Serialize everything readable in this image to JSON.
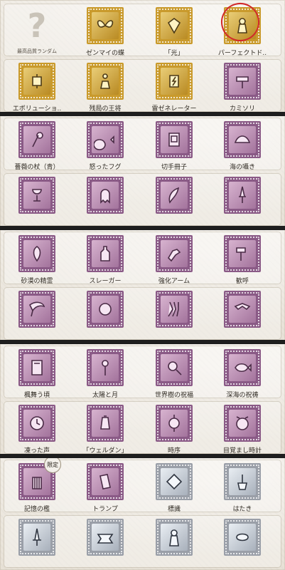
{
  "sections": [
    {
      "rows": [
        {
          "items": [
            {
              "label": "最高品質ランダム",
              "kind": "question",
              "small": true
            },
            {
              "label": "ゼンマイの蝶",
              "kind": "gold",
              "icon": "butterfly-icon"
            },
            {
              "label": "「光」",
              "kind": "gold",
              "icon": "gem-icon"
            },
            {
              "label": "パーフェクトド..",
              "kind": "gold",
              "icon": "doll-icon",
              "circled": true
            }
          ]
        },
        {
          "items": [
            {
              "label": "エボリューショ..",
              "kind": "gold",
              "icon": "mechanism-icon"
            },
            {
              "label": "残局の王将",
              "kind": "gold",
              "icon": "pawn-icon"
            },
            {
              "label": "雷ゼネレーター",
              "kind": "gold",
              "icon": "generator-icon"
            },
            {
              "label": "カミソリ",
              "kind": "purple",
              "icon": "razor-icon"
            }
          ]
        }
      ]
    },
    {
      "rows": [
        {
          "items": [
            {
              "label": "薔薇の杖（青）",
              "kind": "purple",
              "icon": "rose-staff-icon"
            },
            {
              "label": "怒ったフグ",
              "kind": "purple",
              "icon": "pufferfish-icon"
            },
            {
              "label": "切手冊子",
              "kind": "purple",
              "icon": "stamp-book-icon"
            },
            {
              "label": "海の囁き",
              "kind": "purple",
              "icon": "shell-icon"
            }
          ]
        },
        {
          "items": [
            {
              "label": "",
              "kind": "purple",
              "icon": "goblet-icon"
            },
            {
              "label": "",
              "kind": "purple",
              "icon": "ghost-icon"
            },
            {
              "label": "",
              "kind": "purple",
              "icon": "quill-icon"
            },
            {
              "label": "",
              "kind": "purple",
              "icon": "dagger-icon"
            }
          ]
        }
      ]
    },
    {
      "rows": [
        {
          "items": [
            {
              "label": "砂漠の精霊",
              "kind": "purple",
              "icon": "spirit-icon"
            },
            {
              "label": "スレーガー",
              "kind": "purple",
              "icon": "bottle-icon"
            },
            {
              "label": "強化アーム",
              "kind": "purple",
              "icon": "arm-icon"
            },
            {
              "label": "歓呼",
              "kind": "purple",
              "icon": "hammer-icon"
            }
          ]
        },
        {
          "items": [
            {
              "label": "",
              "kind": "purple",
              "icon": "scythe-icon"
            },
            {
              "label": "",
              "kind": "purple",
              "icon": "orb-icon"
            },
            {
              "label": "",
              "kind": "purple",
              "icon": "claw-icon"
            },
            {
              "label": "",
              "kind": "purple",
              "icon": "boomerang-icon"
            }
          ]
        }
      ]
    },
    {
      "rows": [
        {
          "items": [
            {
              "label": "楓舞う頃",
              "kind": "purple",
              "icon": "card-icon"
            },
            {
              "label": "太陽と月",
              "kind": "purple",
              "icon": "scepter-icon"
            },
            {
              "label": "世界樹の祝福",
              "kind": "purple",
              "icon": "magnifier-icon"
            },
            {
              "label": "深海の祝祷",
              "kind": "purple",
              "icon": "fish-icon"
            }
          ]
        },
        {
          "items": [
            {
              "label": "凍った声",
              "kind": "purple",
              "icon": "clock-icon"
            },
            {
              "label": "「ウェルダン」",
              "kind": "purple",
              "icon": "lantern-icon"
            },
            {
              "label": "時序",
              "kind": "purple",
              "icon": "watch-icon"
            },
            {
              "label": "目覚まし時計",
              "kind": "purple",
              "icon": "alarm-icon"
            }
          ]
        }
      ]
    },
    {
      "rows": [
        {
          "items": [
            {
              "label": "記憶の檻",
              "kind": "purple",
              "icon": "cage-icon",
              "limited": "限定"
            },
            {
              "label": "トランプ",
              "kind": "purple",
              "icon": "cards-icon"
            },
            {
              "label": "標識",
              "kind": "silver",
              "icon": "sign-icon"
            },
            {
              "label": "はたき",
              "kind": "silver",
              "icon": "duster-icon"
            }
          ]
        },
        {
          "items": [
            {
              "label": "",
              "kind": "silver",
              "icon": "sword-icon"
            },
            {
              "label": "",
              "kind": "silver",
              "icon": "ribbon-icon"
            },
            {
              "label": "",
              "kind": "silver",
              "icon": "figure-icon"
            },
            {
              "label": "",
              "kind": "silver",
              "icon": "lemon-icon"
            }
          ]
        }
      ]
    }
  ]
}
